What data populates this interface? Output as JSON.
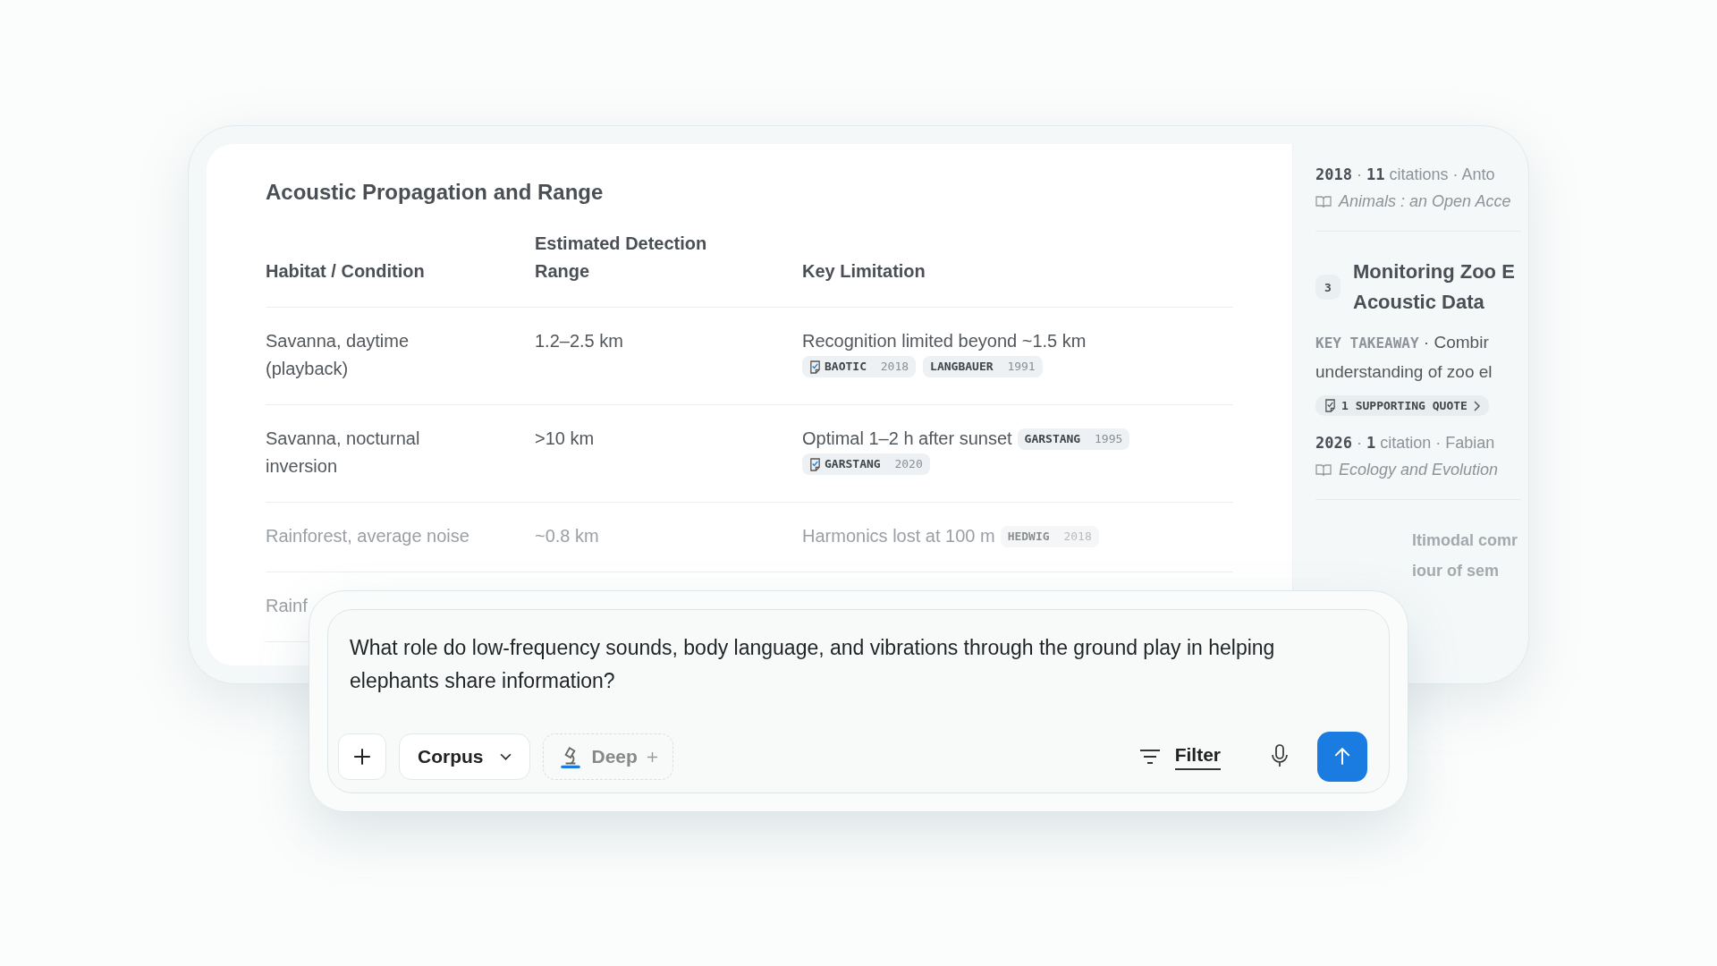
{
  "section": {
    "title": "Acoustic Propagation and Range",
    "columns": [
      "Habitat / Condition",
      "Estimated Detection Range",
      "Key Limitation"
    ],
    "rows": [
      {
        "faded": false,
        "habitat": "Savanna, daytime (playback)",
        "range": "1.2–2.5 km",
        "limitation": "Recognition limited beyond ~1.5 km",
        "inline": [],
        "citations": [
          {
            "author": "BAOTIC",
            "year": "2018",
            "quote": true
          },
          {
            "author": "LANGBAUER",
            "year": "1991",
            "quote": false
          }
        ]
      },
      {
        "faded": false,
        "habitat": "Savanna, nocturnal inversion",
        "range": ">10 km",
        "limitation": "Optimal 1–2 h after sunset",
        "inline": [
          {
            "author": "GARSTANG",
            "year": "1995",
            "quote": false
          }
        ],
        "citations": [
          {
            "author": "GARSTANG",
            "year": "2020",
            "quote": true
          }
        ]
      },
      {
        "faded": true,
        "habitat": "Rainforest, average noise",
        "range": "~0.8 km",
        "limitation": "Harmonics lost at 100 m",
        "inline": [
          {
            "author": "HEDWIG",
            "year": "2018",
            "quote": false
          }
        ],
        "citations": []
      },
      {
        "faded": true,
        "habitat": "Rainf",
        "range": "",
        "limitation": "",
        "inline": [],
        "citations": []
      }
    ]
  },
  "sources": {
    "separator": "·",
    "top": {
      "year": "2018",
      "count": "11",
      "count_label": "citations",
      "author": "Anto",
      "journal": "Animals : an Open Acce"
    },
    "paper": {
      "number": "3",
      "title_lines": [
        "Monitoring Zoo E",
        "Acoustic Data"
      ],
      "takeaway_label": "KEY TAKEAWAY",
      "takeaway_lines": [
        "Combir",
        "understanding of zoo el"
      ],
      "quote_chip": "1 SUPPORTING QUOTE",
      "year": "2026",
      "count": "1",
      "count_label": "citation",
      "author": "Fabian",
      "journal": "Ecology and Evolution"
    },
    "next_lines": [
      "ltimodal comr",
      "iour of sem"
    ]
  },
  "prompt": {
    "text": "What role do low-frequency sounds, body language, and vibrations through the ground play in helping elephants share information?",
    "corpus": "Corpus",
    "deep": "Deep",
    "filter": "Filter"
  }
}
